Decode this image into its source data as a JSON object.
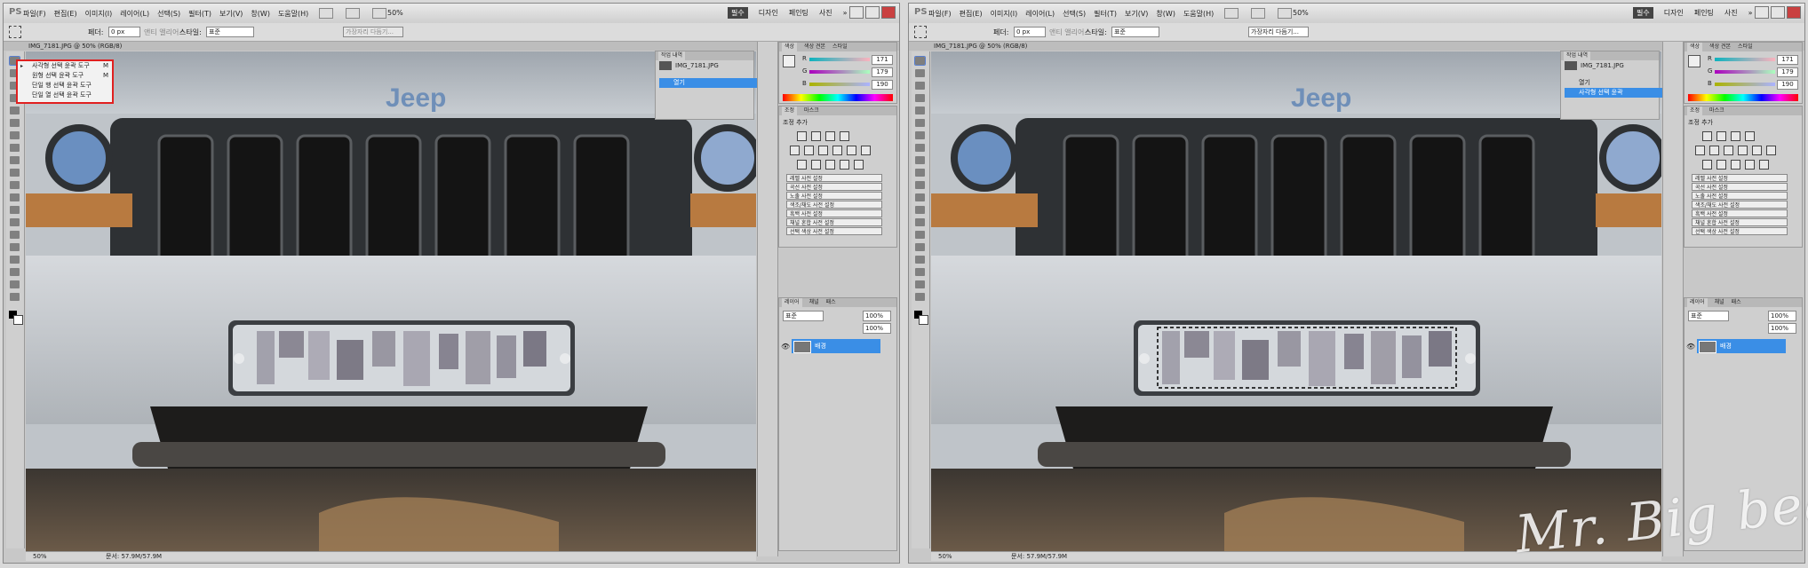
{
  "app": {
    "logo": "PS"
  },
  "menus": [
    "파일(F)",
    "편집(E)",
    "이미지(I)",
    "레이어(L)",
    "선택(S)",
    "필터(T)",
    "보기(V)",
    "창(W)",
    "도움말(H)"
  ],
  "zoom_menu": "50%",
  "workspaces": [
    "필수",
    "디자인",
    "페인팅",
    "사진",
    "»"
  ],
  "options": {
    "feather_label": "페더:",
    "feather_value": "0 px",
    "antialias": "앤티 앨리어스",
    "style_label": "스타일:",
    "style_value": "표준",
    "refine_edge": "가장자리 다듬기..."
  },
  "document": {
    "tab_title": "IMG_7181.JPG @ 50% (RGB/8)",
    "zoom": "50%",
    "doc_size": "문서: 57.9M/57.9M"
  },
  "tool_flyout": {
    "items": [
      {
        "label": "사각형 선택 윤곽 도구",
        "key": "M"
      },
      {
        "label": "원형 선택 윤곽 도구",
        "key": "M"
      },
      {
        "label": "단일 행 선택 윤곽 도구",
        "key": ""
      },
      {
        "label": "단일 열 선택 윤곽 도구",
        "key": ""
      }
    ]
  },
  "history_panel": {
    "tabs": [
      "작업 내역"
    ],
    "snapshot": "IMG_7181.JPG",
    "left_items": [
      "열기"
    ],
    "right_items": [
      "열기",
      "사각형 선택 윤곽"
    ]
  },
  "color_panel": {
    "tabs": [
      "색상",
      "색상 견본",
      "스타일"
    ],
    "r": {
      "label": "R",
      "value": "171"
    },
    "g": {
      "label": "G",
      "value": "179"
    },
    "b": {
      "label": "B",
      "value": "190"
    }
  },
  "adjustments_panel": {
    "tabs": [
      "조정",
      "마스크"
    ],
    "title": "조정 추가",
    "presets": [
      "레벨 사전 설정",
      "곡선 사전 설정",
      "노출 사전 설정",
      "색조/채도 사전 설정",
      "흑백 사전 설정",
      "채널 혼합 사전 설정",
      "선택 색상 사전 설정"
    ]
  },
  "layers_panel": {
    "tabs": [
      "레이어",
      "채널",
      "패스"
    ],
    "blend_mode": "표준",
    "opacity": "100%",
    "fill": "100%",
    "layer_name": "배경"
  },
  "watermark": "Mr. Big bear",
  "colors": {
    "selection_blue": "#3a8ee6",
    "highlight_red": "#e02020"
  }
}
